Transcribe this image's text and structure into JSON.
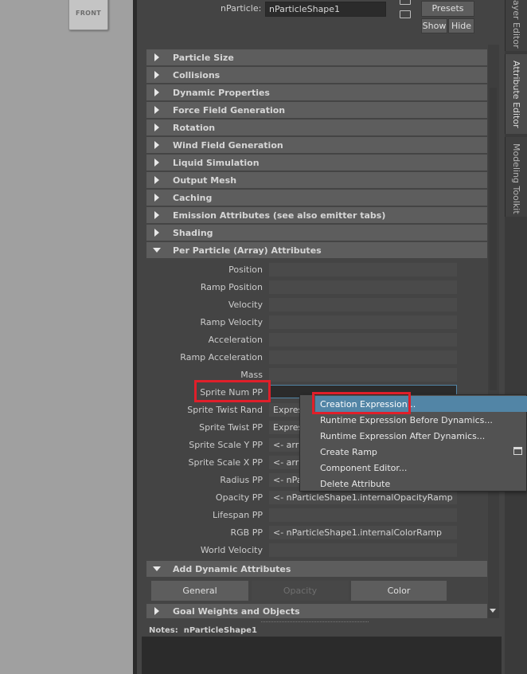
{
  "viewport": {
    "view_cube_label": "FRONT"
  },
  "header": {
    "node_label": "nParticle:",
    "node_value": "nParticleShape1",
    "presets_label": "Presets",
    "show_label": "Show",
    "hide_label": "Hide"
  },
  "sections": [
    {
      "label": "Particle Size",
      "expanded": false
    },
    {
      "label": "Collisions",
      "expanded": false
    },
    {
      "label": "Dynamic Properties",
      "expanded": false
    },
    {
      "label": "Force Field Generation",
      "expanded": false
    },
    {
      "label": "Rotation",
      "expanded": false
    },
    {
      "label": "Wind Field Generation",
      "expanded": false
    },
    {
      "label": "Liquid Simulation",
      "expanded": false
    },
    {
      "label": "Output Mesh",
      "expanded": false
    },
    {
      "label": "Caching",
      "expanded": false
    },
    {
      "label": "Emission Attributes (see also emitter tabs)",
      "expanded": false
    },
    {
      "label": "Shading",
      "expanded": false
    },
    {
      "label": "Per Particle (Array) Attributes",
      "expanded": true
    }
  ],
  "per_particle_attributes": [
    {
      "label": "Position",
      "value": ""
    },
    {
      "label": "Ramp Position",
      "value": ""
    },
    {
      "label": "Velocity",
      "value": ""
    },
    {
      "label": "Ramp Velocity",
      "value": ""
    },
    {
      "label": "Acceleration",
      "value": ""
    },
    {
      "label": "Ramp Acceleration",
      "value": ""
    },
    {
      "label": "Mass",
      "value": ""
    },
    {
      "label": "Sprite Num PP",
      "value": ""
    },
    {
      "label": "Sprite Twist Rand",
      "value": "Expres"
    },
    {
      "label": "Sprite Twist PP",
      "value": "Expres"
    },
    {
      "label": "Sprite Scale Y PP",
      "value": "<- arra"
    },
    {
      "label": "Sprite Scale X PP",
      "value": "<- arra"
    },
    {
      "label": "Radius PP",
      "value": "<- nPa"
    },
    {
      "label": "Opacity PP",
      "value": "<- nParticleShape1.internalOpacityRamp"
    },
    {
      "label": "Lifespan PP",
      "value": ""
    },
    {
      "label": "RGB PP",
      "value": "<- nParticleShape1.internalColorRamp"
    },
    {
      "label": "World Velocity",
      "value": ""
    }
  ],
  "add_dynamic_attributes": {
    "label": "Add Dynamic Attributes",
    "buttons": [
      {
        "label": "General",
        "enabled": true
      },
      {
        "label": "Opacity",
        "enabled": false
      },
      {
        "label": "Color",
        "enabled": true
      }
    ]
  },
  "goal_section": {
    "label": "Goal Weights and Objects"
  },
  "notes": {
    "label": "Notes:",
    "value": "nParticleShape1"
  },
  "dock_tabs": [
    "ayer Editor",
    "Attribute Editor",
    "Modeling Toolkit"
  ],
  "context_menu": {
    "items": [
      {
        "label": "Creation Expression...",
        "highlighted": true
      },
      {
        "label": "Runtime Expression Before Dynamics...",
        "highlighted": false
      },
      {
        "label": "Runtime Expression After Dynamics...",
        "highlighted": false
      },
      {
        "label": "Create Ramp",
        "highlighted": false
      },
      {
        "label": "Component Editor...",
        "highlighted": false
      },
      {
        "label": "Delete Attribute",
        "highlighted": false
      }
    ]
  },
  "colors": {
    "highlight": "#5285a6",
    "annotation_red": "#e01f2a",
    "panel_bg": "#444444",
    "section_bg": "#5d5d5d"
  }
}
